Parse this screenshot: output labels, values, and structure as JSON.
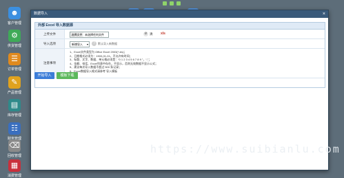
{
  "desktop": {
    "apps": [
      {
        "label": "客户管理",
        "icon": "user-icon",
        "color": "#3b8fe0"
      },
      {
        "label": "供货管理",
        "icon": "gear-icon",
        "color": "#3faa58"
      },
      {
        "label": "订单管理",
        "icon": "order-icon",
        "color": "#e08a1e"
      },
      {
        "label": "产品管理",
        "icon": "edit-icon",
        "color": "#e0a21e"
      },
      {
        "label": "库存管理",
        "icon": "clipboard-icon",
        "color": "#2f8a8a"
      },
      {
        "label": "财务管理",
        "icon": "finance-icon",
        "color": "#3a6fbf"
      },
      {
        "label": "回收管理",
        "icon": "trash-icon",
        "color": "#8a8a8a"
      },
      {
        "label": "消费管理",
        "icon": "wallet-icon",
        "color": "#c9303c"
      }
    ]
  },
  "dialog": {
    "title": "数据导入",
    "close_glyph": "×",
    "panel_title": "外部 Excel 导入数据源",
    "file_row": {
      "label": "上传文件",
      "button": "选择文件",
      "value": "未选择任何文件",
      "clear_label": "清",
      "excel_label": "xls"
    },
    "type_row": {
      "label": "导入选项",
      "select_value": "新增导入",
      "help_text": "默认导入新数据"
    },
    "notes_row": {
      "label": "注意事项",
      "items": [
        "1、Excel文件类型为 Office Excel 2003(*.xls)；",
        "2、日期格式必须为：1900-01-01，不允许有时间；",
        "3、标题、文字、数据、单元格必须是：“0 1 2 3 4 5 6 7 8 9 ”，“-”；",
        "4、金额、电话、Excel列表中存在，不显示，否则无效数据不显示公式；",
        "5、建议每次导入数据不超过 500 条记录；",
        "6、Excel数据导入格式请参考 导入模板"
      ]
    },
    "buttons": {
      "start_import": "开始导入",
      "template_download": "模板下载"
    }
  },
  "watermark": "https://www.suibianlu.com"
}
